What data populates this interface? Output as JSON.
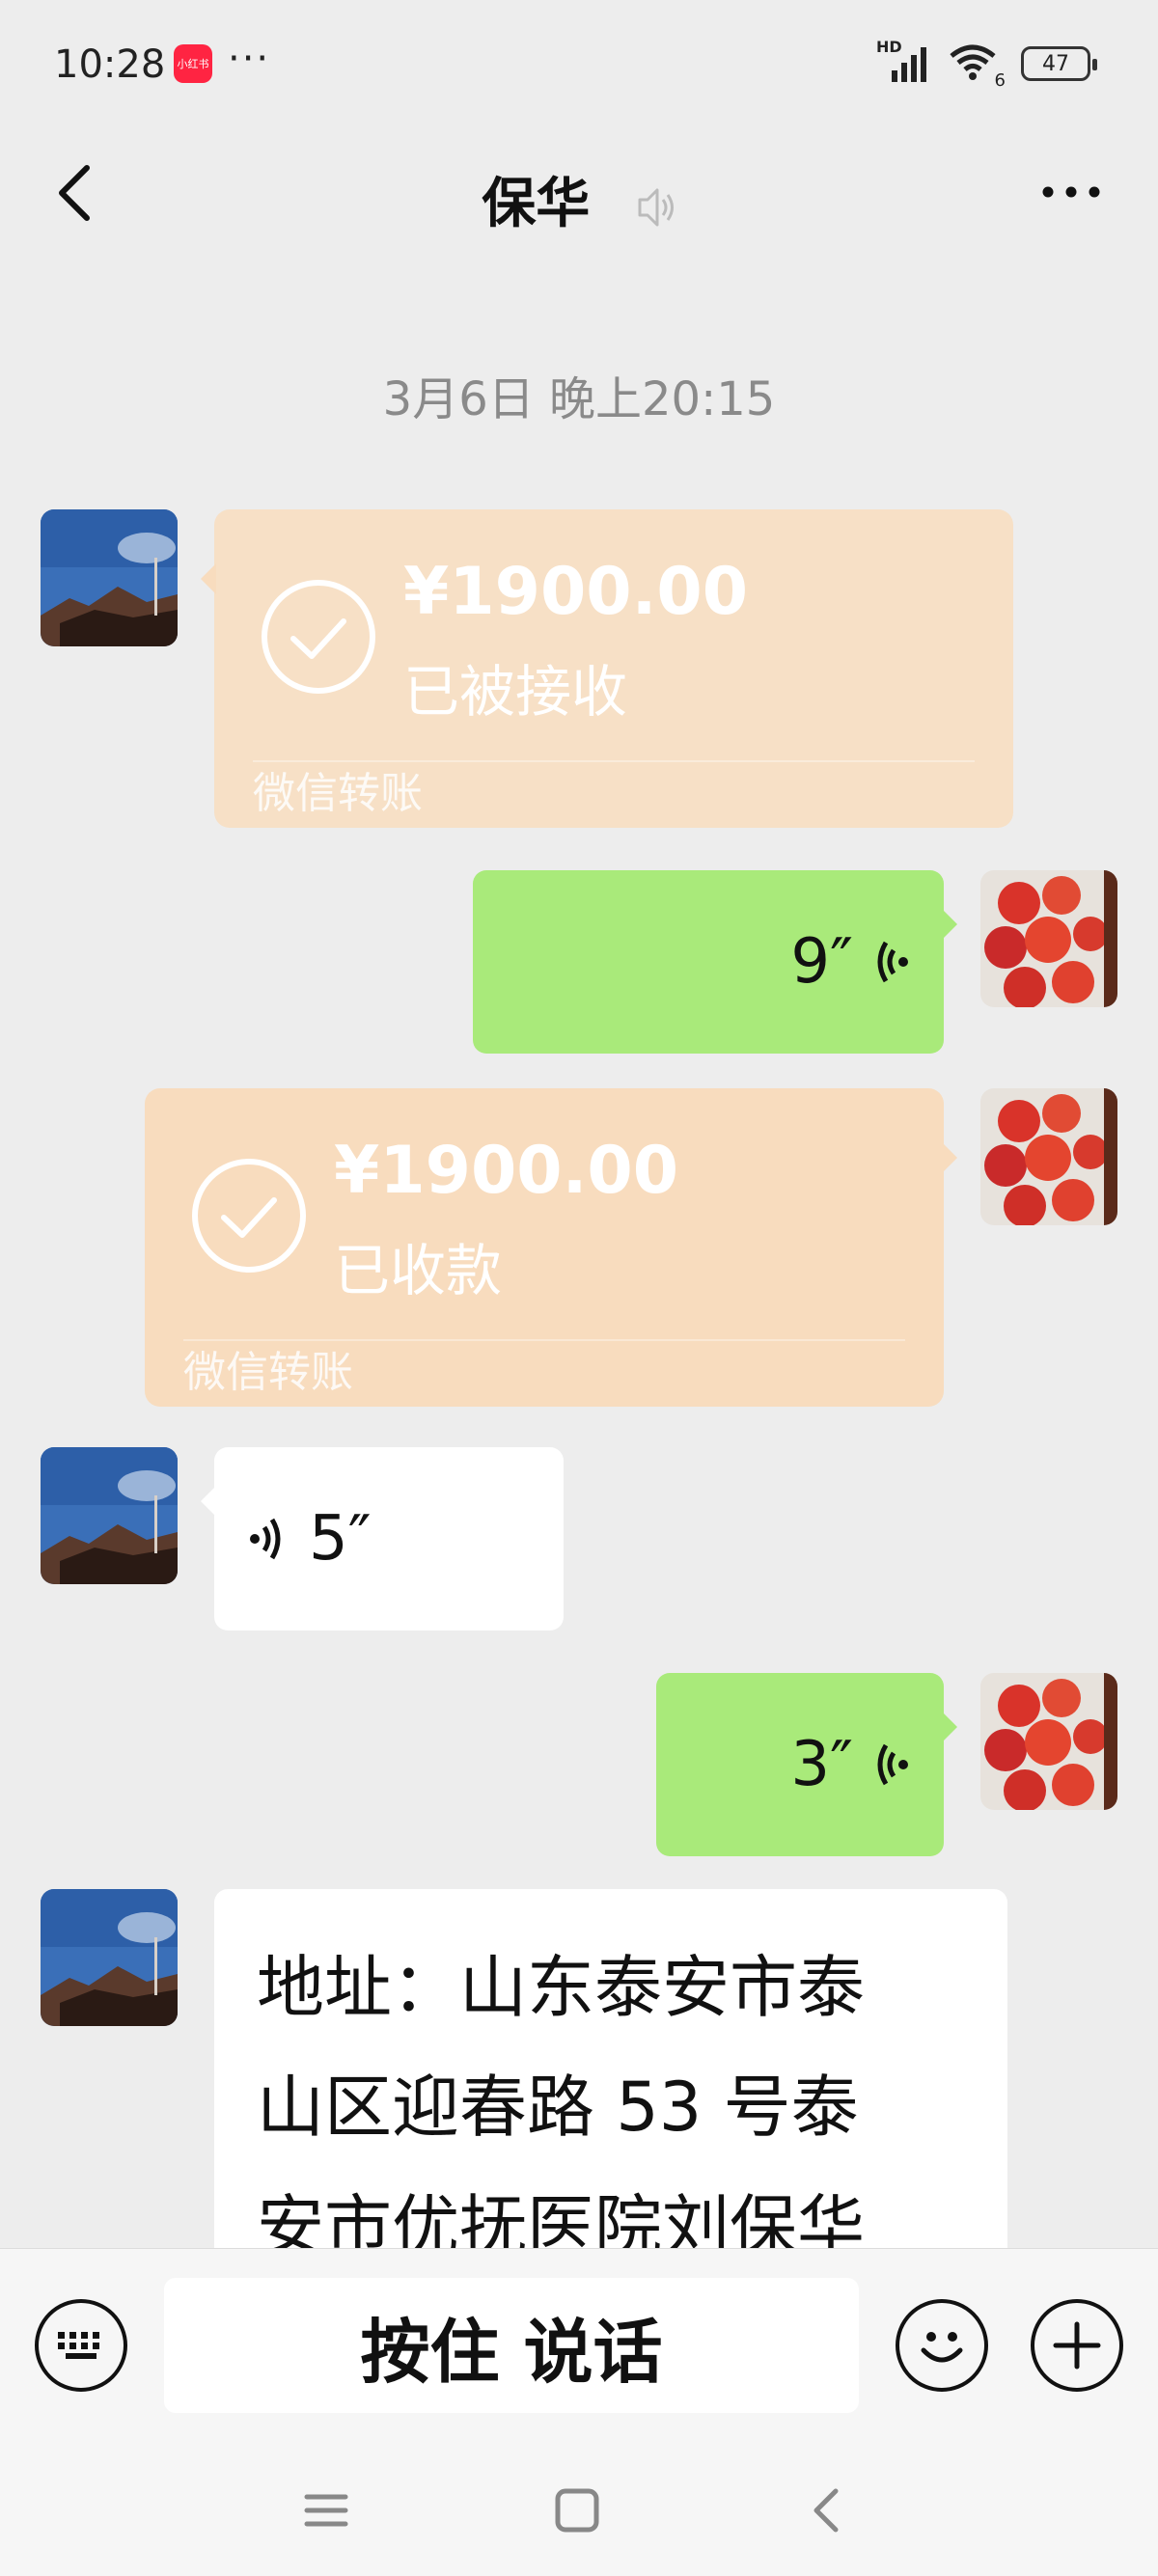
{
  "status_bar": {
    "time": "10:28",
    "app_badge": "小红书",
    "more_dots": "···",
    "network": "HD",
    "wifi_index": "6",
    "battery": "47"
  },
  "header": {
    "title": "保华",
    "icons": [
      "back-icon",
      "mute-icon",
      "more-icon"
    ]
  },
  "timestamp": "3月6日 晚上20:15",
  "messages": [
    {
      "type": "transfer",
      "side": "left",
      "amount": "¥1900.00",
      "status": "已被接收",
      "footer": "微信转账"
    },
    {
      "type": "voice",
      "side": "right",
      "duration": "9″"
    },
    {
      "type": "transfer",
      "side": "right",
      "amount": "¥1900.00",
      "status": "已收款",
      "footer": "微信转账"
    },
    {
      "type": "voice",
      "side": "left",
      "duration": "5″"
    },
    {
      "type": "voice",
      "side": "right",
      "duration": "3″"
    },
    {
      "type": "text",
      "side": "left",
      "lines": [
        "地址：山东泰安市泰",
        "山区迎春路 53 号泰",
        "安市优抚医院刘保华"
      ]
    }
  ],
  "input_bar": {
    "hold_to_talk": "按住 说话",
    "icons": [
      "keyboard-icon",
      "emoji-icon",
      "plus-icon"
    ]
  },
  "nav_bar": {
    "icons": [
      "menu-icon",
      "home-icon",
      "back-icon"
    ]
  },
  "colors": {
    "background": "#ededed",
    "transfer": "#f8dcbe",
    "outgoing": "#a9ea7a",
    "incoming": "#ffffff"
  }
}
